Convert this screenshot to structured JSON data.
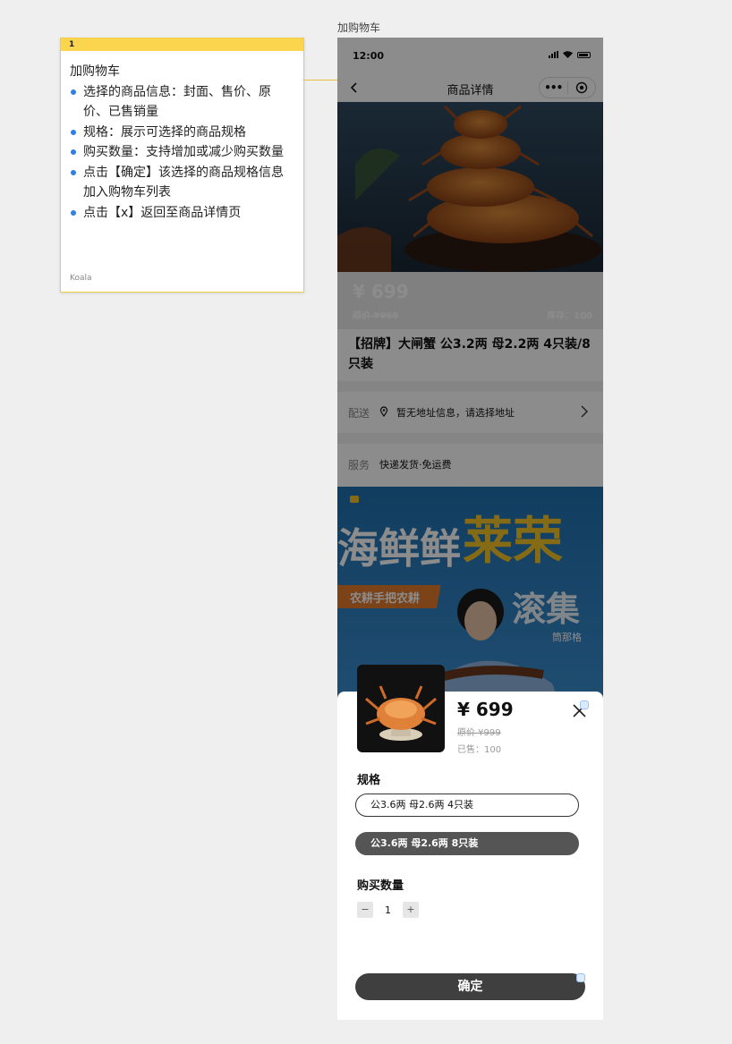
{
  "frame_label": "加购物车",
  "note": {
    "number": "1",
    "title": "加购物车",
    "items": [
      "选择的商品信息：封面、售价、原价、已售销量",
      "规格：展示可选择的商品规格",
      "购买数量：支持增加或减少购买数量",
      "点击【确定】该选择的商品规格信息加入购物车列表",
      "点击【x】返回至商品详情页"
    ],
    "author": "Koala"
  },
  "status_bar": {
    "time": "12:00"
  },
  "nav": {
    "title": "商品详情",
    "more_label": "•••"
  },
  "product": {
    "price": "¥ 699",
    "original_price": "原价 ¥999",
    "stock": "库存：100",
    "title": "【招牌】大闸蟹 公3.2两 母2.2两 4只装/8只装"
  },
  "delivery": {
    "label": "配送",
    "value": "暂无地址信息，请选择地址"
  },
  "service": {
    "label": "服务",
    "value": "快递发货·免运费"
  },
  "banner": {
    "headline_1": "海鲜鲜",
    "headline_2": "莱荣",
    "tag": "农耕手把农耕",
    "right_text": "滚集",
    "right_small": "筒那格"
  },
  "sheet": {
    "price": "¥ 699",
    "original_price": "原价 ¥999",
    "sold": "已售：100",
    "spec_label": "规格",
    "specs": [
      "公3.6两  母2.6两  4只装",
      "公3.6两  母2.6两  8只装"
    ],
    "qty_label": "购买数量",
    "minus": "−",
    "qty": "1",
    "plus": "+",
    "confirm": "确定"
  },
  "colors": {
    "note_yellow": "#fbd54d",
    "bullet_blue": "#2f7fe6",
    "confirm_bg": "#3f3f3f",
    "selected_spec_bg": "#555555"
  }
}
